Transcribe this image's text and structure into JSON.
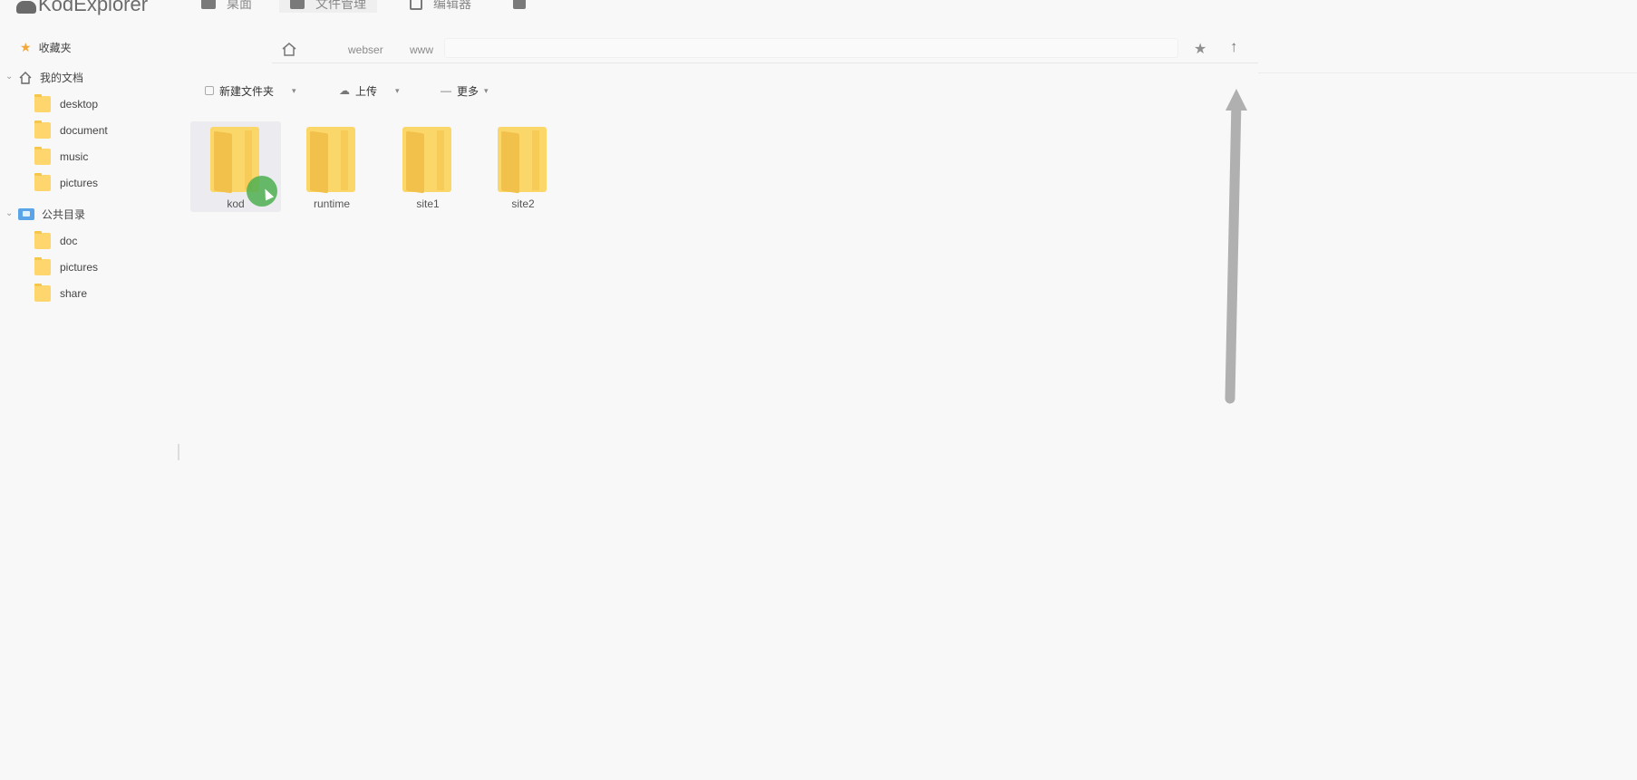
{
  "app": {
    "title": "KodExplorer",
    "nav": [
      {
        "label": "桌面",
        "icon": "monitor-icon"
      },
      {
        "label": "文件管理",
        "icon": "folder-manage-icon"
      },
      {
        "label": "编辑器",
        "icon": "edit-icon"
      },
      {
        "label": "",
        "icon": "grid-icon"
      }
    ]
  },
  "sidebar": {
    "favorites": "收藏夹",
    "my_docs": {
      "label": "我的文档",
      "children": [
        "desktop",
        "document",
        "music",
        "pictures"
      ]
    },
    "public": {
      "label": "公共目录",
      "children": [
        "doc",
        "pictures",
        "share"
      ]
    }
  },
  "address": {
    "crumbs": [
      "webser",
      "www"
    ],
    "home_icon": "home-icon",
    "star_icon": "star-icon",
    "up_icon": "arrow-up-icon"
  },
  "toolbar": {
    "new_folder": "新建文件夹",
    "upload": "上传",
    "more": "更多"
  },
  "files": [
    {
      "name": "kod",
      "selected": true
    },
    {
      "name": "runtime",
      "selected": false
    },
    {
      "name": "site1",
      "selected": false
    },
    {
      "name": "site2",
      "selected": false
    }
  ],
  "colors": {
    "folder": "#fbd76a",
    "accent_star": "#f2a73b",
    "public_dir": "#5aa5e8",
    "cursor_highlight": "#4caf50",
    "annotation_arrow": "#b0b0b0"
  }
}
